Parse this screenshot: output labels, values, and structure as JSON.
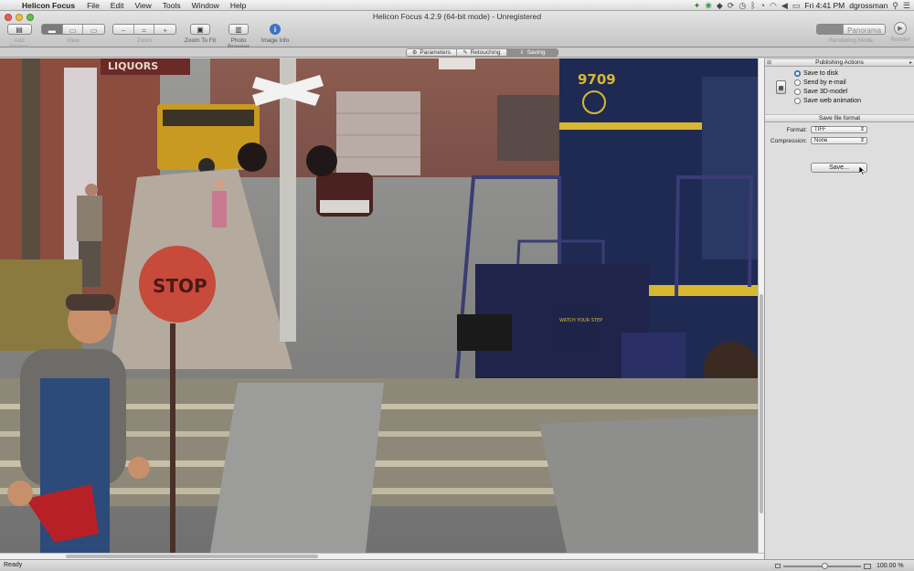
{
  "menubar": {
    "app_name": "Helicon Focus",
    "menus": [
      "File",
      "Edit",
      "View",
      "Tools",
      "Window",
      "Help"
    ],
    "clock": "Fri 4:41 PM",
    "user": "dgrossman",
    "status_icons": [
      "paw-icon",
      "evernote-icon",
      "dropbox-icon",
      "sync-icon",
      "timer-icon",
      "bluetooth-icon",
      "timemachine-icon",
      "wifi-icon",
      "volume-icon",
      "battery-icon",
      "spotlight-icon",
      "list-icon"
    ]
  },
  "window": {
    "title": "Helicon Focus 4.2.9 (64-bit mode) - Unregistered"
  },
  "toolbar": {
    "add_images": "Add Images",
    "view": "View",
    "zoom": "Zoom",
    "zoom_to_fit": "Zoom To Fit",
    "photo_browser": "Photo Browser",
    "image_info": "Image Info",
    "rendering_mode_label": "Rendering Mode",
    "rendering_mode_value": "Panorama",
    "render": "Render"
  },
  "tabs": [
    {
      "label": "Parameters",
      "icon": "gear-icon"
    },
    {
      "label": "Retouching",
      "icon": "pencil-icon"
    },
    {
      "label": "Saving",
      "icon": "save-icon",
      "active": true
    }
  ],
  "panel": {
    "publishing_title": "Publishing Actions",
    "options": [
      {
        "label": "Save to disk",
        "selected": true
      },
      {
        "label": "Send by e-mail",
        "selected": false
      },
      {
        "label": "Save 3D-model",
        "selected": false
      },
      {
        "label": "Save web animation",
        "selected": false
      }
    ],
    "format_title": "Save file format",
    "format_label": "Format:",
    "format_value": "TIFF",
    "compression_label": "Compression:",
    "compression_value": "None",
    "save_button": "Save..."
  },
  "photo": {
    "sign_liquors": "LIQUORS",
    "sign_stop": "STOP",
    "loco_number": "9709",
    "step_text": "WATCH YOUR STEP"
  },
  "status": {
    "text": "Ready",
    "zoom": "100.00 %"
  }
}
